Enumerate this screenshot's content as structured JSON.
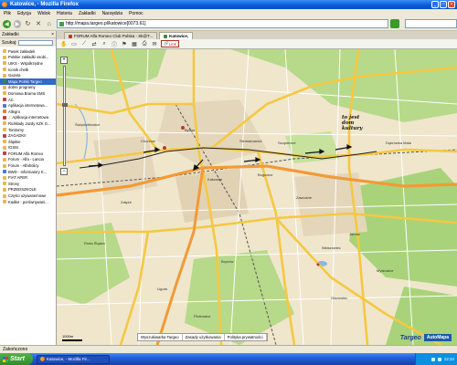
{
  "window": {
    "title": "Katowice, - Mozilla Firefox"
  },
  "menu": [
    "Plik",
    "Edycja",
    "Widok",
    "Historia",
    "Zakładki",
    "Narzędzia",
    "Pomoc"
  ],
  "nav": {
    "url": "http://mapa.targeo.pl/katowice[0073.61]"
  },
  "sidebar": {
    "title": "Zakładki",
    "search_label": "Szukaj:",
    "items": [
      {
        "label": "Pasek zakładek",
        "color": "#e8b84a"
      },
      {
        "label": "Polskie zakładki osobi...",
        "color": "#e8b84a"
      },
      {
        "label": "UIKS - Współrzędne",
        "color": "#e8b84a"
      },
      {
        "label": "Iconik chełb",
        "color": "#e8b84a"
      },
      {
        "label": "Gazeta",
        "color": "#e8b84a"
      },
      {
        "label": "Mapa Polski Targeo",
        "color": "#3a8a3a"
      },
      {
        "label": "dobre programy",
        "color": "#e8b84a"
      },
      {
        "label": "Domowa Brama SMS",
        "color": "#e8b84a"
      },
      {
        "label": "AC",
        "color": "#c04040"
      },
      {
        "label": "Aplikacja internetowa...",
        "color": "#4a7ac0"
      },
      {
        "label": "Allegro",
        "color": "#e08030"
      },
      {
        "label": ".:: Aplikacja internetowa",
        "color": "#c04040"
      },
      {
        "label": "Rozkłady Jazdy KZK G...",
        "color": "#e8b84a"
      },
      {
        "label": "Tomtomy",
        "color": "#e8b84a"
      },
      {
        "label": "ZAGADKI!",
        "color": "#c04040"
      },
      {
        "label": "Śląskie",
        "color": "#e8b84a"
      },
      {
        "label": "IGSM",
        "color": "#e8b84a"
      },
      {
        "label": "FORUM Alfa Romeo",
        "color": "#c04040"
      },
      {
        "label": "Forum - Alfa - Lancia",
        "color": "#e8b84a"
      },
      {
        "label": "Forum - Alfaholicy",
        "color": "#e8b84a"
      },
      {
        "label": "BWD - Informatory K...",
        "color": "#4a7ac0"
      },
      {
        "label": "FIAT APER",
        "color": "#e8b84a"
      },
      {
        "label": "Strony",
        "color": "#e8b84a"
      },
      {
        "label": "PRZEDSZKOLE",
        "color": "#e8b84a"
      },
      {
        "label": "Części używane/nowe",
        "color": "#e8b84a"
      },
      {
        "label": "Kadłar - porównywani...",
        "color": "#e8b84a"
      }
    ]
  },
  "tabs": [
    {
      "label": "FORUM Alfa Romeo Club Polska - Sk@T...",
      "active": false
    },
    {
      "label": "Katowice,",
      "active": true
    }
  ],
  "maptools": {
    "link_label": "Link"
  },
  "map": {
    "places": [
      {
        "label": "Bytom"
      },
      {
        "label": "Chorzów"
      },
      {
        "label": "Świętochłowice"
      },
      {
        "label": "Siemianowice"
      },
      {
        "label": "Katowice"
      },
      {
        "label": "Szopienice"
      },
      {
        "label": "Mysłowice"
      },
      {
        "label": "Ruda Śląska"
      },
      {
        "label": "Załęże"
      },
      {
        "label": "Ligota"
      },
      {
        "label": "Brynów"
      },
      {
        "label": "Giszowiec"
      },
      {
        "label": "Bogucice"
      },
      {
        "label": "Zawodzie"
      },
      {
        "label": "Janów"
      },
      {
        "label": "Nikiszowiec"
      },
      {
        "label": "Dąbrówka Mała"
      },
      {
        "label": "Piotrowice"
      }
    ],
    "annotation": "to jest\ndom\nkultury",
    "scale": "1000m",
    "links": [
      "Wyszukiwarka Targeo",
      "Zasady użytkowania",
      "Polityka prywatności"
    ],
    "brand1": "Targeo",
    "brand2": "AutoMapa"
  },
  "status": "Zakończono",
  "taskbar": {
    "start": "Start",
    "task": "Katowice, - Mozilla Fir...",
    "clock": "12:34"
  }
}
